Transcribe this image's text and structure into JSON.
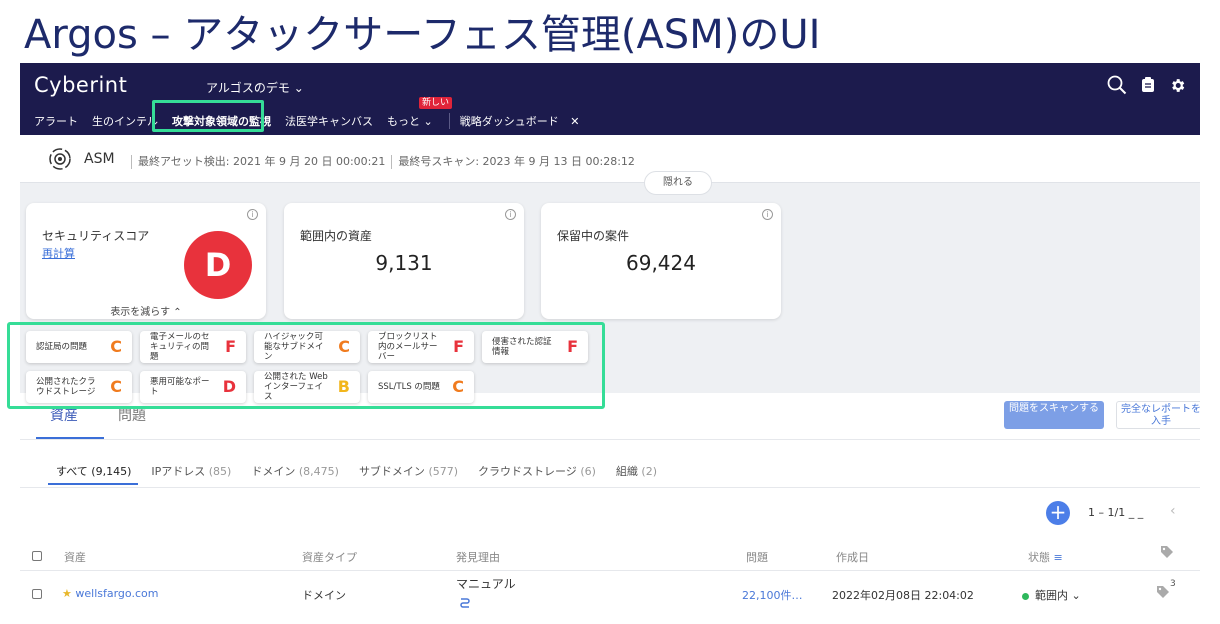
{
  "title": "Argos – アタックサーフェス管理(ASM)のUI",
  "navbar": {
    "logo": "Cyberint",
    "workspace": "アルゴスのデモ ⌄",
    "tabs": [
      {
        "label": "アラート"
      },
      {
        "label": "生のインテル"
      },
      {
        "label": "攻撃対象領域の監視"
      },
      {
        "label": "法医学キャンバス"
      },
      {
        "label": "もっと ⌄"
      }
    ],
    "new_badge": "新しい",
    "pinned_tab": "戦略ダッシュボード",
    "close_symbol": "✕"
  },
  "subheader": {
    "module": "ASM",
    "last_asset": "最終アセット検出: 2021 年 9 月 20 日 00:00:21",
    "last_scan": "最終号スキャン: 2023 年 9 月 13 日 00:28:12",
    "hide_button": "隠れる"
  },
  "cards": {
    "security": {
      "title": "セキュリティスコア",
      "recalc": "再計算",
      "grade": "D",
      "show_less": "表示を減らす ⌃"
    },
    "assets": {
      "title": "範囲内の資産",
      "value": "9,131"
    },
    "cases": {
      "title": "保留中の案件",
      "value": "69,424"
    }
  },
  "issues": [
    {
      "label": "認証局の問題",
      "grade": "C",
      "color": "#f07b1e"
    },
    {
      "label": "電子メールのセキュリティの問題",
      "grade": "F",
      "color": "#e8323c"
    },
    {
      "label": "ハイジャック可能なサブドメイン",
      "grade": "C",
      "color": "#f07b1e"
    },
    {
      "label": "ブロックリスト内のメールサーバー",
      "grade": "F",
      "color": "#e8323c"
    },
    {
      "label": "侵害された認証情報",
      "grade": "F",
      "color": "#e8323c"
    },
    {
      "label": "公開されたクラウドストレージ",
      "grade": "C",
      "color": "#f07b1e"
    },
    {
      "label": "悪用可能なポート",
      "grade": "D",
      "color": "#e8323c"
    },
    {
      "label": "公開された Web インターフェイス",
      "grade": "B",
      "color": "#f2b61c"
    },
    {
      "label": "SSL/TLS の問題",
      "grade": "C",
      "color": "#f07b1e"
    }
  ],
  "main_tabs": {
    "assets": "資産",
    "issues": "問題"
  },
  "actions": {
    "scan": "問題をスキャンする",
    "report": "完全なレポートを入手"
  },
  "sub_tabs": [
    {
      "label": "すべて",
      "count": "(9,145)"
    },
    {
      "label": "IPアドレス",
      "count": "(85)"
    },
    {
      "label": "ドメイン",
      "count": "(8,475)"
    },
    {
      "label": "サブドメイン",
      "count": "(577)"
    },
    {
      "label": "クラウドストレージ",
      "count": "(6)"
    },
    {
      "label": "組織",
      "count": "(2)"
    }
  ],
  "pager": {
    "add": "+",
    "range": "1 – 1/1 _ _",
    "prev": "‹"
  },
  "table": {
    "headers": {
      "asset": "資産",
      "type": "資産タイプ",
      "reason": "発見理由",
      "issues": "問題",
      "created": "作成日",
      "status": "状態"
    },
    "rows": [
      {
        "asset": "wellsfargo.com",
        "type": "ドメイン",
        "reason": "マニュアル",
        "issues": "22,100件…",
        "created": "2022年02月08日 22:04:02",
        "status": "範囲内 ⌄",
        "tags": "3"
      }
    ]
  }
}
